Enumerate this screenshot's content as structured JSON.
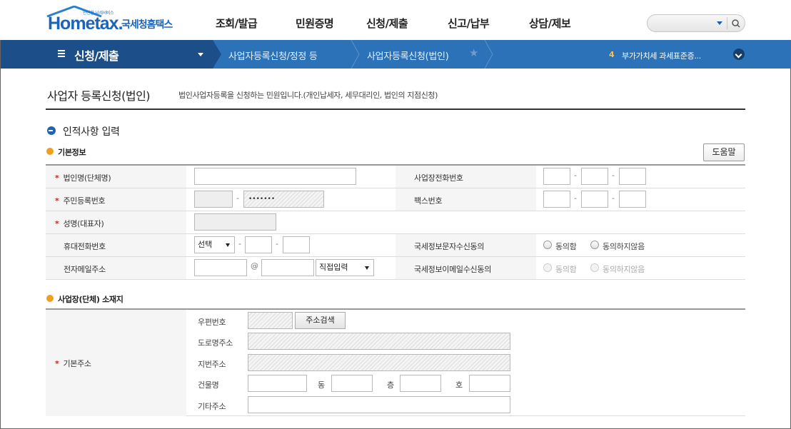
{
  "header": {
    "logo_small": "안전한 납세서비스",
    "logo_main": "Hometax.",
    "logo_ko": "국세청홈택스",
    "menu": [
      "조회/발급",
      "민원증명",
      "신청/제출",
      "신고/납부",
      "상담/제보"
    ]
  },
  "navbar": {
    "title": "신청/제출",
    "crumbs": [
      "사업자등록신청/정정 등",
      "사업자등록신청(법인)"
    ],
    "notice_num": "4",
    "notice_text": "부가가치세 과세표준증..."
  },
  "page": {
    "title": "사업자 등록신청(법인)",
    "desc": "법인사업자등록을 신청하는 민원입니다.(개인납세자, 세무대리인, 법인의 지점신청)"
  },
  "section1": {
    "title": "인적사항 입력",
    "subtitle": "기본정보",
    "help": "도움말",
    "fields": {
      "corp_name": "법인명(단체명)",
      "biz_phone": "사업장전화번호",
      "resident_no": "주민등록번호",
      "resident_masked": "•••••••",
      "fax": "팩스번호",
      "name": "성명(대표자)",
      "mobile": "휴대전화번호",
      "mobile_select": "선택",
      "sms_agree": "국세정보문자수신동의",
      "email": "전자메일주소",
      "at": "@",
      "email_select": "직접입력",
      "email_agree": "국세정보이메일수신동의",
      "agree": "동의함",
      "disagree": "동의하지않음"
    }
  },
  "section2": {
    "subtitle": "사업장(단체) 소재지",
    "basic_addr": "기본주소",
    "zip": "우편번호",
    "addr_search": "주소검색",
    "road_addr": "도로명주소",
    "jibun_addr": "지번주소",
    "building": "건물명",
    "dong": "동",
    "floor": "층",
    "ho": "호",
    "etc_addr": "기타주소"
  }
}
